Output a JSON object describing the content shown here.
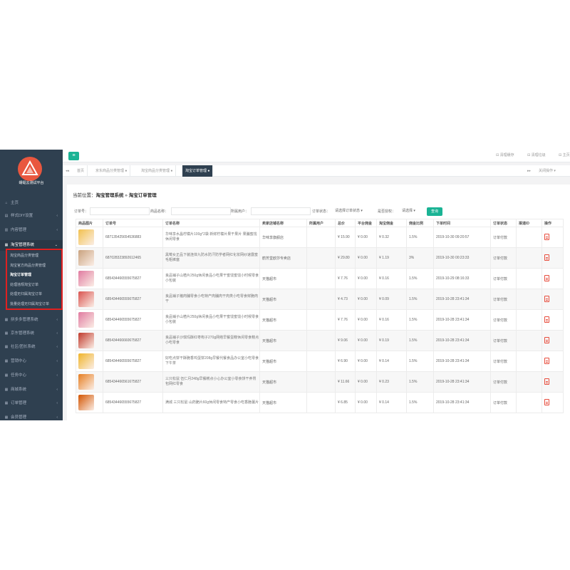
{
  "app": {
    "logo_text": "蜻蜓云测试平台"
  },
  "sidebar": {
    "items": [
      {
        "label": "主页",
        "icon": "home-icon"
      },
      {
        "label": "样式DIY设置",
        "icon": "palette-icon"
      },
      {
        "label": "内容管理",
        "icon": "content-icon"
      },
      {
        "label": "淘宝管理系统",
        "icon": "taobao-icon"
      },
      {
        "label": "拼多多管理系统",
        "icon": "pdd-icon"
      },
      {
        "label": "京东管理系统",
        "icon": "jd-icon"
      },
      {
        "label": "社区/团长系统",
        "icon": "community-icon"
      },
      {
        "label": "营销中心",
        "icon": "marketing-icon"
      },
      {
        "label": "任务中心",
        "icon": "task-icon"
      },
      {
        "label": "商城系统",
        "icon": "mall-icon"
      },
      {
        "label": "订单管理",
        "icon": "order-icon"
      },
      {
        "label": "会员管理",
        "icon": "member-icon"
      }
    ],
    "subitems": [
      "淘宝商品分类管理",
      "淘宝官方商品分类管理",
      "淘宝订单管理",
      "处理违规淘宝订单",
      "处理无归属淘宝订单",
      "批量处理无归属淘宝订单"
    ]
  },
  "topbar": {
    "clear_cache": "清理缓存",
    "clear_log": "清理垃圾",
    "home": "主页"
  },
  "tabs": [
    "首页",
    "京东商品分类管理",
    "淘宝商品分类管理",
    "淘宝订单管理"
  ],
  "tab_actions": "关闭操作",
  "breadcrumb": {
    "prefix": "当前位置：",
    "section": "淘宝管理系统",
    "sep": " » ",
    "page": "淘宝订单管理"
  },
  "filters": {
    "order_no": "订单号：",
    "product_name": "商品名称：",
    "user": "所属用户：",
    "status_label": "订单状态：",
    "status_value": "请选择订单状态",
    "authorized_label": "是否授权：",
    "authorized_value": "请选择",
    "search_button": "查询"
  },
  "table": {
    "columns": [
      "商品图片",
      "订单号",
      "订单名称",
      "卖家店铺名称",
      "所属用户",
      "总价",
      "平台佣金",
      "淘宝佣金",
      "佣金比例",
      "下单时间",
      "订单状态",
      "渠道ID",
      "操作"
    ],
    "rows": [
      {
        "order": "687135425654536883",
        "name": "华味享水晶柠檬片100g*2袋 新鲜柠檬片果干果片 果脯蜜饯休闲零食",
        "shop": "华味享旗舰店",
        "user": "",
        "total": "¥ 15.90",
        "platform": "¥ 0.00",
        "taobao": "¥ 0.32",
        "rate": "1.5%",
        "time": "2019-10-30 09:20:57",
        "status": "订单付款",
        "channel": "",
        "thumb": "#f2c14e"
      },
      {
        "order": "687028323892612465",
        "name": "黑莓女正品下装连体九防水防汗防学者网红化妆网纱速露蜜毛粗裤塞",
        "shop": "鹤芳堂欧莎专卖店",
        "user": "",
        "total": "¥ 29.80",
        "platform": "¥ 0.00",
        "taobao": "¥ 1.19",
        "rate": "3%",
        "time": "2019-10-30 00:23:33",
        "status": "订单付款",
        "channel": "",
        "thumb": "#c9a27e"
      },
      {
        "order": "685434466555675827",
        "name": "良品铺子山楂片250g休闲食品小吃果干蜜饯蜜饯小时候零食小包装",
        "shop": "天猫超市",
        "user": "",
        "total": "¥ 7.76",
        "platform": "¥ 0.00",
        "taobao": "¥ 0.16",
        "rate": "1.5%",
        "time": "2019-10-29 08:16:33",
        "status": "订单付款",
        "channel": "",
        "thumb": "#e07aa0"
      },
      {
        "order": "685434466555675827",
        "name": "良品铺子猪肉脯零食小吃特产肉脯肉干肉类小吃零食鲜脆肉干",
        "shop": "天猫超市",
        "user": "",
        "total": "¥ 4.73",
        "platform": "¥ 0.00",
        "taobao": "¥ 0.09",
        "rate": "1.5%",
        "time": "2019-10-28 23:41:34",
        "status": "订单付款",
        "channel": "",
        "thumb": "#d9534f"
      },
      {
        "order": "685434466555675827",
        "name": "良品铺子山楂片250g休闲食品小吃果干蜜饯蜜饯小时候零食小包装",
        "shop": "天猫超市",
        "user": "",
        "total": "¥ 7.76",
        "platform": "¥ 0.00",
        "taobao": "¥ 0.16",
        "rate": "1.5%",
        "time": "2019-10-28 23:41:34",
        "status": "订单付款",
        "channel": "",
        "thumb": "#e07aa0"
      },
      {
        "order": "685434466660675827",
        "name": "良品铺子沙琪玛酥红枣枸子270g网络早餐蛋糕休闲零食糕点小吃零食",
        "shop": "天猫超市",
        "user": "",
        "total": "¥ 9.06",
        "platform": "¥ 0.00",
        "taobao": "¥ 0.19",
        "rate": "1.5%",
        "time": "2019-10-28 23:41:34",
        "status": "订单付款",
        "channel": "",
        "thumb": "#c0392b"
      },
      {
        "order": "685434466555675827",
        "name": "好吃点饼干酥脆香鸡蛋饼208g早餐代餐食品办公室小吃零食下午茶",
        "shop": "天猫超市",
        "user": "",
        "total": "¥ 6.90",
        "platform": "¥ 0.00",
        "taobao": "¥ 0.14",
        "rate": "1.5%",
        "time": "2019-10-28 23:41:34",
        "status": "订单付款",
        "channel": "",
        "thumb": "#f0b429"
      },
      {
        "order": "685434466561675827",
        "name": "三只松鼠 伍仁月248g早餐糕点小心办公室小零食饼干养胃包网红零食",
        "shop": "天猫超市",
        "user": "",
        "total": "¥ 11.66",
        "platform": "¥ 0.00",
        "taobao": "¥ 0.23",
        "rate": "1.5%",
        "time": "2019-10-28 23:41:34",
        "status": "订单付款",
        "channel": "",
        "thumb": "#e67e22"
      },
      {
        "order": "685434466555675827",
        "name": "满城 三只松鼠 山药脆片60g休闲零食特产零食小吃香脆薯片",
        "shop": "天猫超市",
        "user": "",
        "total": "¥ 6.85",
        "platform": "¥ 0.00",
        "taobao": "¥ 0.14",
        "rate": "1.5%",
        "time": "2019-10-28 23:41:34",
        "status": "订单付款",
        "channel": "",
        "thumb": "#d35400"
      }
    ]
  },
  "colors": {
    "sidebar_bg": "#2f4050",
    "accent": "#1ab394",
    "highlight_border": "#e02020",
    "active_tab": "#2f4050"
  }
}
